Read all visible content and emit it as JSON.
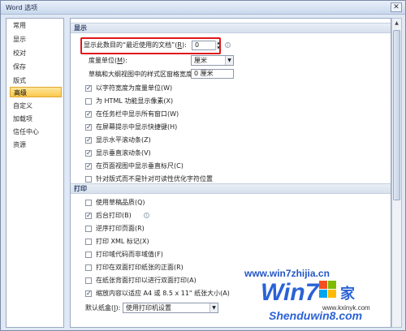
{
  "window": {
    "title": "Word 选项",
    "close_glyph": "✕"
  },
  "sidebar": {
    "items": [
      {
        "label": "常用",
        "active": false
      },
      {
        "label": "显示",
        "active": false
      },
      {
        "label": "校对",
        "active": false
      },
      {
        "label": "保存",
        "active": false
      },
      {
        "label": "版式",
        "active": false
      },
      {
        "label": "高级",
        "active": true
      },
      {
        "label": "自定义",
        "active": false
      },
      {
        "label": "加载项",
        "active": false
      },
      {
        "label": "信任中心",
        "active": false
      },
      {
        "label": "资源",
        "active": false
      }
    ]
  },
  "display_section": {
    "title": "显示",
    "recent_docs": {
      "label": "显示此数目的“最近使用的文档”(",
      "hotkey": "R",
      "suffix": "):",
      "value": "0"
    },
    "measure_unit": {
      "label": "度量单位(",
      "hotkey": "M",
      "suffix": "):",
      "value": "厘米"
    },
    "style_width": {
      "label": "草稿和大纲视图中的样式区窗格宽度(",
      "hotkey": "E",
      "suffix": "):",
      "value": "0 厘米"
    },
    "checkboxes": [
      {
        "label": "以字符宽度为度量单位(W)",
        "checked": true
      },
      {
        "label": "为 HTML 功能显示像素(X)",
        "checked": false
      },
      {
        "label": "在任务栏中显示所有窗口(W)",
        "checked": true
      },
      {
        "label": "在屏幕提示中显示快捷键(H)",
        "checked": true
      },
      {
        "label": "显示水平滚动条(Z)",
        "checked": true
      },
      {
        "label": "显示垂直滚动条(V)",
        "checked": true
      },
      {
        "label": "在页面视图中显示垂直标尺(C)",
        "checked": true
      },
      {
        "label": "针对版式而不是针对可读性优化字符位置",
        "checked": false
      }
    ]
  },
  "print_section": {
    "title": "打印",
    "checkboxes": [
      {
        "label": "使用草稿品质(Q)",
        "checked": false
      },
      {
        "label": "后台打印(B)",
        "checked": true
      },
      {
        "label": "逆序打印页面(R)",
        "checked": false
      },
      {
        "label": "打印 XML 标记(X)",
        "checked": false
      },
      {
        "label": "打印域代码而非域值(F)",
        "checked": false
      },
      {
        "label": "打印在双面打印纸张的正面(R)",
        "checked": false
      },
      {
        "label": "在纸张背面打印以进行双面打印(A)",
        "checked": false
      },
      {
        "label": "缩放内容以适应 A4 或 8.5 x 11\" 纸张大小(A)",
        "checked": true
      }
    ],
    "default_tray": {
      "label": "默认纸盒(",
      "hotkey": "I",
      "suffix": "):",
      "value": "使用打印机设置"
    }
  },
  "watermark": {
    "site1": "www.win7zhijia.cn",
    "site2": "www.kxinyk.com",
    "logo_text": "Win7",
    "logo_suffix": "家",
    "shendu": "Shenduwin8.com"
  },
  "colors": {
    "highlight": "#e01818",
    "active_item": "#fbc94e",
    "section_header": "#d7e0ed"
  }
}
